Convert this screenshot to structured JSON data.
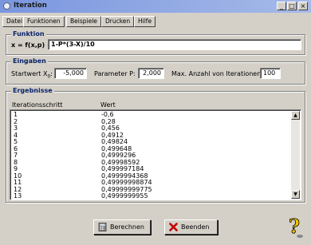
{
  "window": {
    "title": "Iteration"
  },
  "titlebar_buttons": {
    "minimize": "_",
    "maximize": "□",
    "close": "×"
  },
  "menu": [
    "Datei",
    "Funktionen",
    "Beispiele",
    "Drucken",
    "Hilfe"
  ],
  "funktion": {
    "legend": "Funktion",
    "label": "x = f(x,p) =",
    "value": "1-P*(3-X)/10"
  },
  "eingaben": {
    "legend": "Eingaben",
    "start_label": "Startwert X",
    "start_sub": "0",
    "start_colon": ":",
    "start_value": "-5,000",
    "param_label": "Parameter P:",
    "param_value": "2,000",
    "max_label": "Max. Anzahl von Iterationen:",
    "max_value": "100"
  },
  "ergebnisse": {
    "legend": "Ergebnisse",
    "col1": "Iterationsschritt",
    "col2": "Wert",
    "rows": [
      [
        "1",
        "-0,6"
      ],
      [
        "2",
        "0,28"
      ],
      [
        "3",
        "0,456"
      ],
      [
        "4",
        "0,4912"
      ],
      [
        "5",
        "0,49824"
      ],
      [
        "6",
        "0,499648"
      ],
      [
        "7",
        "0,4999296"
      ],
      [
        "8",
        "0,49998592"
      ],
      [
        "9",
        "0,499997184"
      ],
      [
        "10",
        "0,4999994368"
      ],
      [
        "11",
        "0,49999998874"
      ],
      [
        "12",
        "0,49999999775"
      ],
      [
        "13",
        "0,4999999955"
      ]
    ]
  },
  "buttons": {
    "berechnen": "Berechnen",
    "beenden": "Beenden"
  }
}
